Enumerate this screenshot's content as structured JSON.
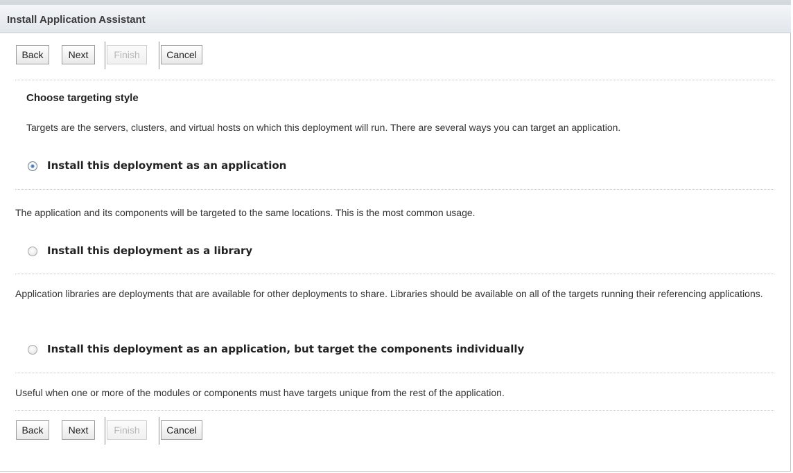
{
  "title": "Install Application Assistant",
  "buttons": {
    "back": "Back",
    "next": "Next",
    "finish": "Finish",
    "cancel": "Cancel"
  },
  "section": {
    "heading": "Choose targeting style",
    "intro": "Targets are the servers, clusters, and virtual hosts on which this deployment will run. There are several ways you can target an application."
  },
  "options": [
    {
      "label": "Install this deployment as an application",
      "description": "The application and its components will be targeted to the same locations. This is the most common usage.",
      "selected": true
    },
    {
      "label": "Install this deployment as a library",
      "description": "Application libraries are deployments that are available for other deployments to share. Libraries should be available on all of the targets running their referencing applications.",
      "selected": false
    },
    {
      "label": "Install this deployment as an application, but target the components individually",
      "description": "Useful when one or more of the modules or components must have targets unique from the rest of the application.",
      "selected": false
    }
  ]
}
